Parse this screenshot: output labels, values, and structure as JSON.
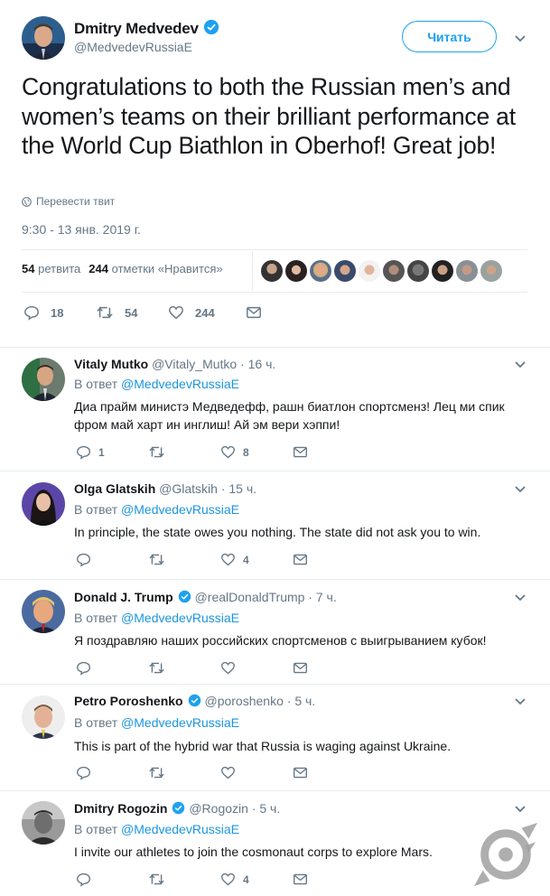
{
  "main_tweet": {
    "author_name": "Dmitry Medvedev",
    "author_handle": "@MedvedevRussiaE",
    "follow_label": "Читать",
    "text": "Congratulations to both the Russian men’s and women’s teams on their brilliant performance at the World Cup Biathlon in Oberhof! Great job!",
    "translate_label": "Перевести твит",
    "timestamp": "9:30 - 13 янв. 2019 г.",
    "retweets_count": "54",
    "retweets_label": "ретвита",
    "likes_count": "244",
    "likes_label": "отметки «Нравится»",
    "actions": {
      "replies": "18",
      "retweets": "54",
      "likes": "244"
    }
  },
  "replies": [
    {
      "name": "Vitaly Mutko",
      "handle": "@Vitaly_Mutko",
      "time": "· 16 ч.",
      "in_reply_prefix": "В ответ",
      "in_reply_to": "@MedvedevRussiaE",
      "text": "Диа прайм министэ Медведефф, рашн биатлон спортсменз! Лец ми спик фром май харт ин инглиш! Ай эм вери хэппи!",
      "replies": "1",
      "retweets": "",
      "likes": "8"
    },
    {
      "name": "Olga Glatskih",
      "handle": "@Glatskih",
      "time": "· 15 ч.",
      "in_reply_prefix": "В ответ",
      "in_reply_to": "@MedvedevRussiaE",
      "text": "In principle, the state owes you nothing. The state did not ask you to win.",
      "replies": "",
      "retweets": "",
      "likes": "4"
    },
    {
      "name": "Donald J. Trump",
      "handle": "@realDonaldTrump",
      "time": "· 7 ч.",
      "in_reply_prefix": "В ответ",
      "in_reply_to": "@MedvedevRussiaE",
      "text": "Я поздравляю наших российских спортсменов с выигрыванием кубок!",
      "replies": "",
      "retweets": "",
      "likes": ""
    },
    {
      "name": "Petro Poroshenko",
      "handle": "@poroshenko",
      "time": "· 5 ч.",
      "in_reply_prefix": "В ответ",
      "in_reply_to": "@MedvedevRussiaE",
      "text": "This is part of the hybrid war that Russia is waging against Ukraine.",
      "replies": "",
      "retweets": "",
      "likes": ""
    },
    {
      "name": "Dmitry Rogozin",
      "handle": "@Rogozin",
      "time": "· 5 ч.",
      "in_reply_prefix": "В ответ",
      "in_reply_to": "@MedvedevRussiaE",
      "text": "I invite our athletes to join the cosmonaut corps to explore Mars.",
      "replies": "",
      "retweets": "",
      "likes": "4"
    }
  ],
  "colors": {
    "accent": "#1da1f2",
    "link": "#1b95e0",
    "muted": "#657786",
    "text": "#14171a",
    "divider": "#e6ecf0"
  },
  "icons": [
    "verified-icon",
    "reply-icon",
    "retweet-icon",
    "like-icon",
    "dm-icon",
    "globe-icon",
    "chevron-down-icon"
  ]
}
